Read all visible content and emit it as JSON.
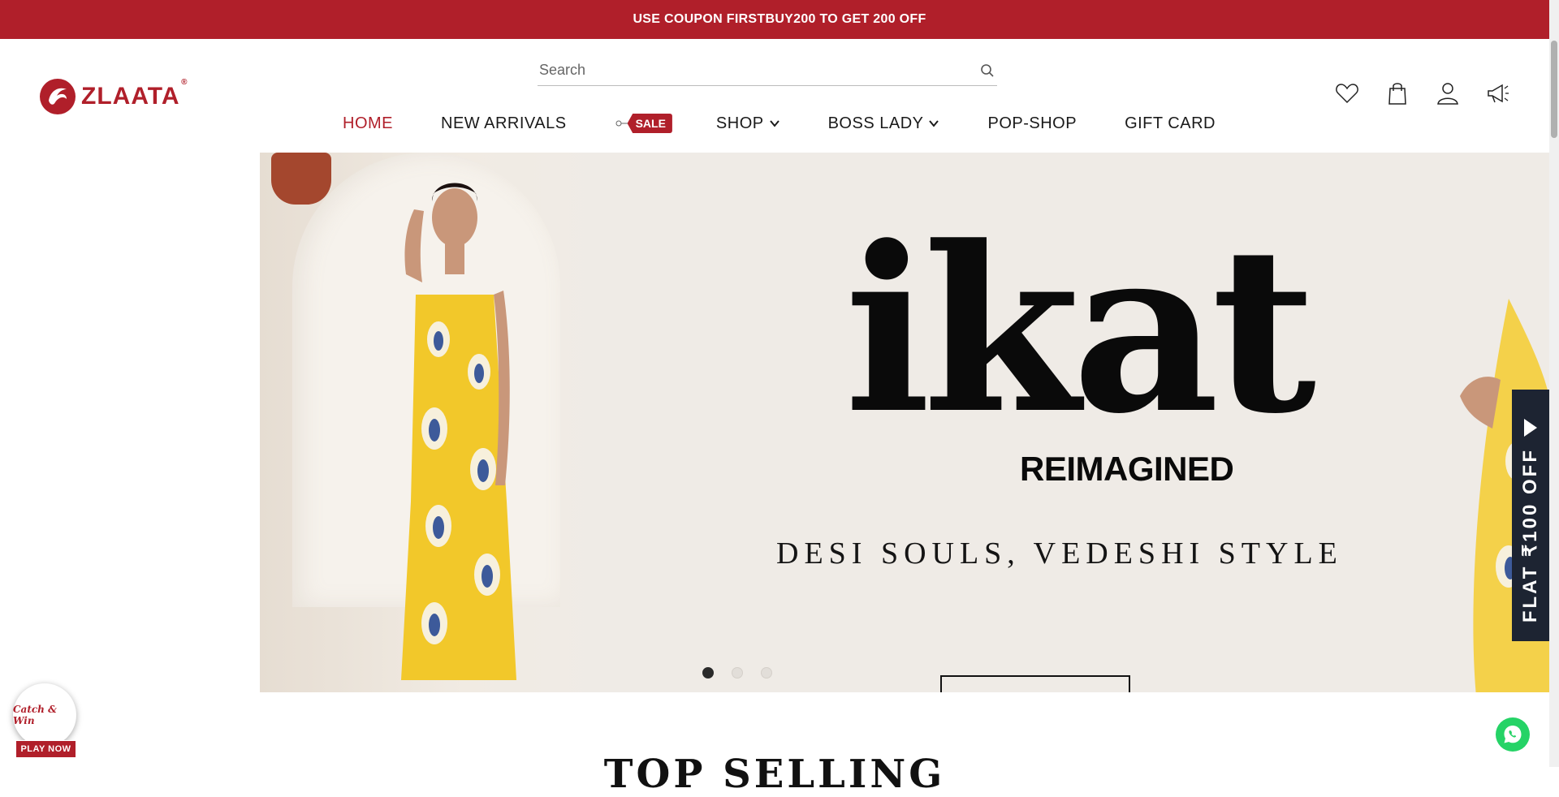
{
  "announcement": {
    "text": "USE COUPON FIRSTBUY200 TO GET 200 OFF"
  },
  "brand": {
    "name": "ZLAATA",
    "registered": "®",
    "color": "#b01f2a"
  },
  "search": {
    "placeholder": "Search",
    "icon": "search-icon"
  },
  "nav": {
    "items": [
      {
        "label": "HOME",
        "active": true
      },
      {
        "label": "NEW ARRIVALS"
      },
      {
        "label": "SALE",
        "badge": true
      },
      {
        "label": "SHOP",
        "dropdown": true
      },
      {
        "label": "BOSS LADY",
        "dropdown": true
      },
      {
        "label": "POP-SHOP"
      },
      {
        "label": "GIFT CARD"
      }
    ]
  },
  "header_icons": [
    "wishlist-heart-icon",
    "shopping-bag-icon",
    "user-account-icon",
    "announcement-megaphone-icon"
  ],
  "hero": {
    "title": "ikat",
    "subtitle": "REIMAGINED",
    "tagline": "DESI SOULS, VEDESHI STYLE",
    "slides": 3,
    "active_slide": 1
  },
  "side_tab": {
    "text": "FLAT ₹100 OFF"
  },
  "section": {
    "heading": "TOP SELLING"
  },
  "catch_win": {
    "title": "Catch & Win",
    "button": "PLAY NOW"
  },
  "floating": {
    "whatsapp": "whatsapp-icon"
  }
}
